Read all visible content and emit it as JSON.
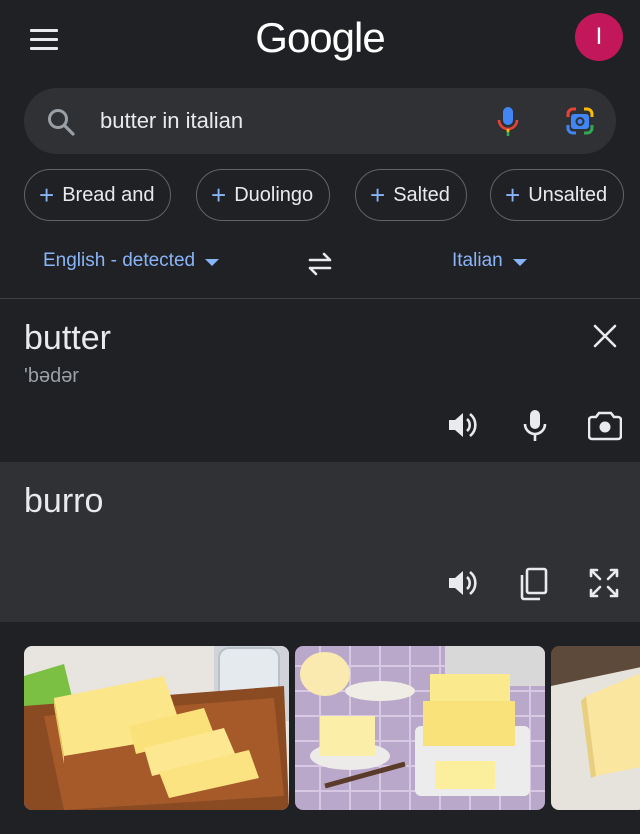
{
  "header": {
    "logo": "Google",
    "avatar_initial": "I",
    "avatar_color": "#c2185b"
  },
  "search": {
    "query": "butter in italian"
  },
  "chips": [
    {
      "label": "Bread and"
    },
    {
      "label": "Duolingo"
    },
    {
      "label": "Salted"
    },
    {
      "label": "Unsalted"
    }
  ],
  "languages": {
    "source": "English - detected",
    "target": "Italian"
  },
  "source": {
    "text": "butter",
    "phonetic": "'bədər"
  },
  "target": {
    "text": "burro"
  },
  "icons": {
    "menu": "menu-icon",
    "search": "search-icon",
    "mic": "mic-icon",
    "lens": "google-lens-icon",
    "swap": "swap-icon",
    "clear": "close-icon",
    "speaker": "speaker-icon",
    "camera": "camera-icon",
    "copy": "copy-icon",
    "fullscreen": "fullscreen-icon"
  },
  "colors": {
    "background": "#202124",
    "surface": "#303134",
    "accent": "#8ab4f8"
  },
  "images": [
    {
      "subject": "butter block slices on wooden board"
    },
    {
      "subject": "butter blocks on checkered tablecloth"
    },
    {
      "subject": "butter block partial"
    }
  ]
}
